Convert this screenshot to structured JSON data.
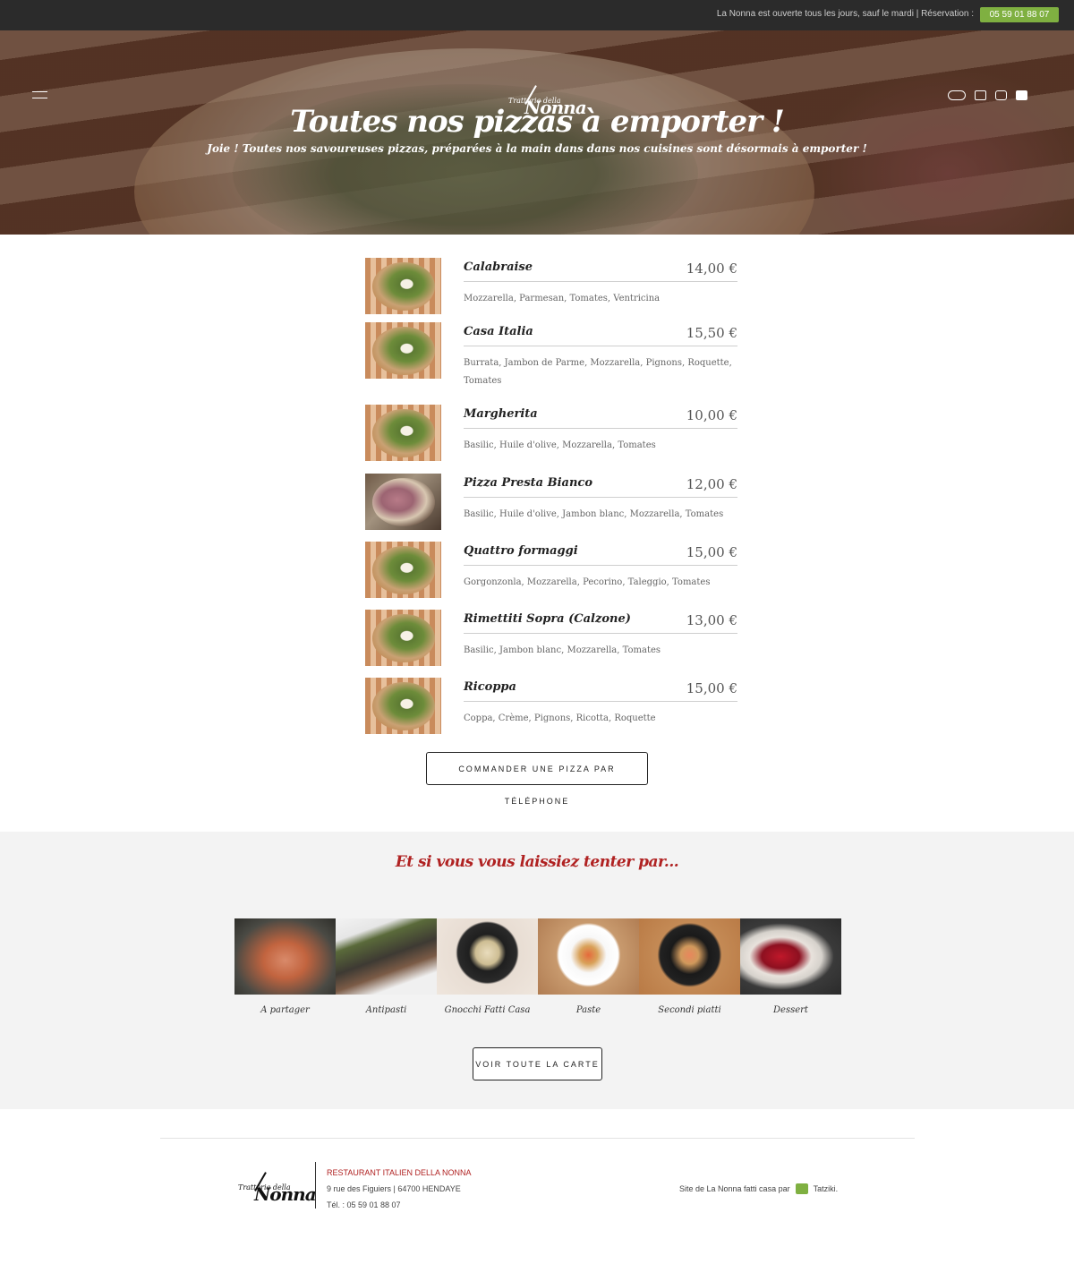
{
  "topbar": {
    "info": "La Nonna est ouverte tous  les jours, sauf le mardi | Réservation :",
    "phone": "05 59 01 88 07"
  },
  "logo": {
    "small": "Trattoria della",
    "big": "Nonna"
  },
  "social": [
    "tripadvisor-icon",
    "facebook-icon",
    "instagram-icon",
    "mail-icon"
  ],
  "hero": {
    "title": "Toutes nos pizzas à emporter !",
    "subtitle": "Joie ! Toutes nos savoureuses pizzas, préparées à la main dans dans nos cuisines sont désormais à emporter !"
  },
  "pizzas": [
    {
      "name": "Calabraise",
      "price": "14,00  €",
      "desc": "Mozzarella, Parmesan, Tomates, Ventricina"
    },
    {
      "name": "Casa Italia",
      "price": "15,50  €",
      "desc": "Burrata, Jambon de Parme, Mozzarella, Pignons, Roquette, Tomates"
    },
    {
      "name": "Margherita",
      "price": "10,00  €",
      "desc": "Basilic, Huile d'olive, Mozzarella, Tomates"
    },
    {
      "name": "Pizza Presta Bianco",
      "price": "12,00  €",
      "desc": "Basilic, Huile d'olive, Jambon blanc, Mozzarella, Tomates"
    },
    {
      "name": "Quattro formaggi",
      "price": "15,00  €",
      "desc": "Gorgonzonla, Mozzarella, Pecorino, Taleggio, Tomates"
    },
    {
      "name": "Rimettiti Sopra (Calzone)",
      "price": "13,00  €",
      "desc": "Basilic, Jambon blanc, Mozzarella, Tomates"
    },
    {
      "name": "Ricoppa",
      "price": "15,00  €",
      "desc": "Coppa, Crème, Pignons, Ricotta, Roquette"
    }
  ],
  "order_button": "COMMANDER UNE PIZZA PAR TÉLÉPHONE",
  "tenter": {
    "title": "Et si vous vous laissiez tenter par...",
    "categories": [
      "A partager",
      "Antipasti",
      "Gnocchi Fatti Casa",
      "Paste",
      "Secondi piatti",
      "Dessert"
    ],
    "button": "VOIR TOUTE LA CARTE"
  },
  "footer": {
    "name": "RESTAURANT ITALIEN DELLA NONNA",
    "address": "9 rue des Figuiers | 64700 HENDAYE",
    "tel": "Tél. : 05 59 01 88 07",
    "credit": "Site de La Nonna fatti casa par",
    "credit_brand": "Tatziki."
  }
}
